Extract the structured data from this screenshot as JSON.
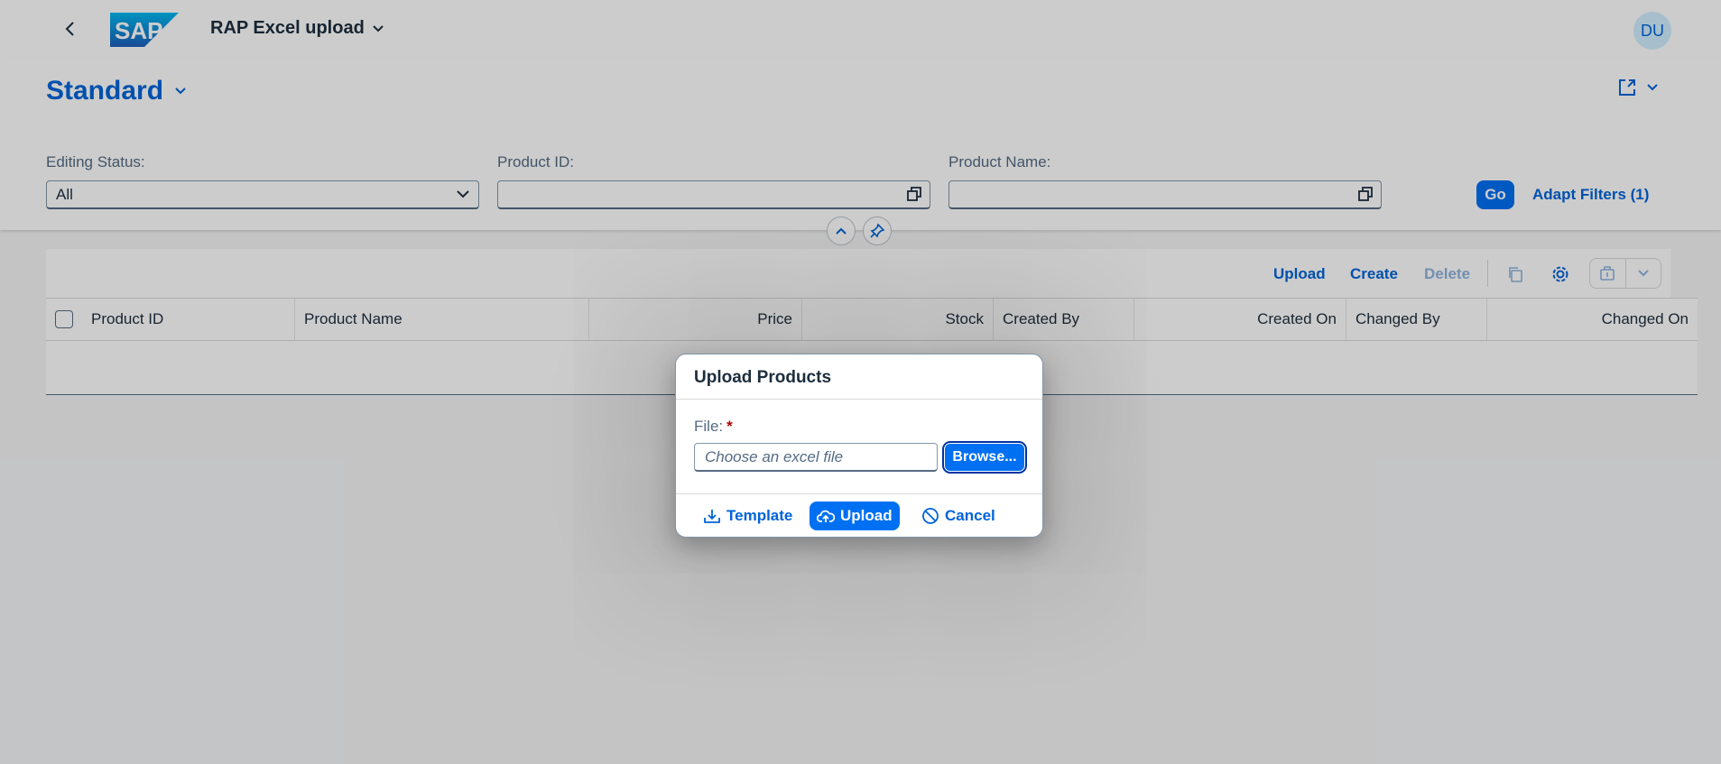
{
  "shell": {
    "app_title": "RAP Excel upload",
    "logo_text": "SAP",
    "avatar_initials": "DU"
  },
  "header": {
    "variant_name": "Standard",
    "filters": [
      {
        "label": "Editing Status:",
        "value": "All"
      },
      {
        "label": "Product ID:",
        "value": ""
      },
      {
        "label": "Product Name:",
        "value": ""
      }
    ],
    "go_label": "Go",
    "adapt_filters_label": "Adapt Filters (1)"
  },
  "table": {
    "toolbar": {
      "upload_label": "Upload",
      "create_label": "Create",
      "delete_label": "Delete"
    },
    "columns": [
      "Product ID",
      "Product Name",
      "Price",
      "Stock",
      "Created By",
      "Created On",
      "Changed By",
      "Changed On"
    ]
  },
  "dialog": {
    "title": "Upload Products",
    "file_label": "File:",
    "required_marker": "*",
    "file_placeholder": "Choose an excel file",
    "browse_label": "Browse...",
    "template_label": "Template",
    "upload_label": "Upload",
    "cancel_label": "Cancel"
  },
  "colors": {
    "accent": "#0070f2",
    "link": "#0064d9",
    "overlay": "rgba(0,0,0,0.2)"
  }
}
